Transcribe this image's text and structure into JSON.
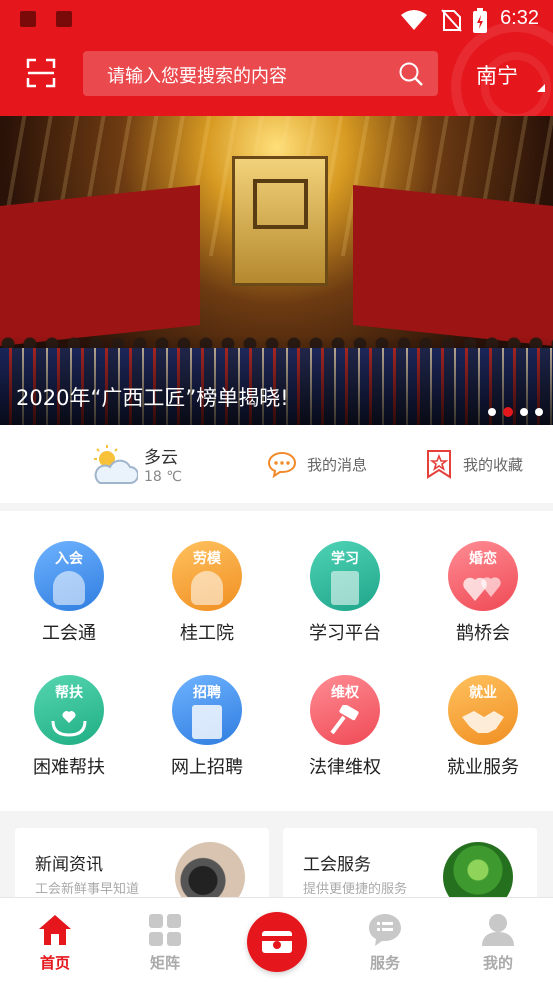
{
  "status_bar": {
    "time": "6:32"
  },
  "header": {
    "search_placeholder": "请输入您要搜索的内容",
    "city": "南宁"
  },
  "banner": {
    "caption": "2020年“广西工匠”榜单揭晓!",
    "slide_count": 4,
    "active_slide": 2
  },
  "info": {
    "weather": {
      "condition": "多云",
      "temperature": "18 ℃",
      "icon": "partly-cloudy-icon"
    },
    "messages_label": "我的消息",
    "favorites_label": "我的收藏"
  },
  "grid": {
    "items": [
      {
        "tag": "入会",
        "label": "工会通",
        "color": "#3d8ff0"
      },
      {
        "tag": "劳模",
        "label": "桂工院",
        "color": "#f7a23a"
      },
      {
        "tag": "学习",
        "label": "学习平台",
        "color": "#25b39a"
      },
      {
        "tag": "婚恋",
        "label": "鹊桥会",
        "color": "#f2575f"
      },
      {
        "tag": "帮扶",
        "label": "困难帮扶",
        "color": "#28b58c"
      },
      {
        "tag": "招聘",
        "label": "网上招聘",
        "color": "#3d8ff0"
      },
      {
        "tag": "维权",
        "label": "法律维权",
        "color": "#ef5a5f"
      },
      {
        "tag": "就业",
        "label": "就业服务",
        "color": "#f6a43a"
      }
    ]
  },
  "cards": [
    {
      "title": "新闻资讯",
      "subtitle": "工会新鲜事早知道"
    },
    {
      "title": "工会服务",
      "subtitle": "提供更便捷的服务"
    }
  ],
  "nav": {
    "items": [
      {
        "label": "首页",
        "icon": "home-icon",
        "active": true
      },
      {
        "label": "矩阵",
        "icon": "grid-icon",
        "active": false
      },
      {
        "label": "",
        "icon": "wallet-icon",
        "active": false
      },
      {
        "label": "服务",
        "icon": "list-bubble-icon",
        "active": false
      },
      {
        "label": "我的",
        "icon": "user-icon",
        "active": false
      }
    ]
  },
  "colors": {
    "brand_red": "#e5161c"
  }
}
